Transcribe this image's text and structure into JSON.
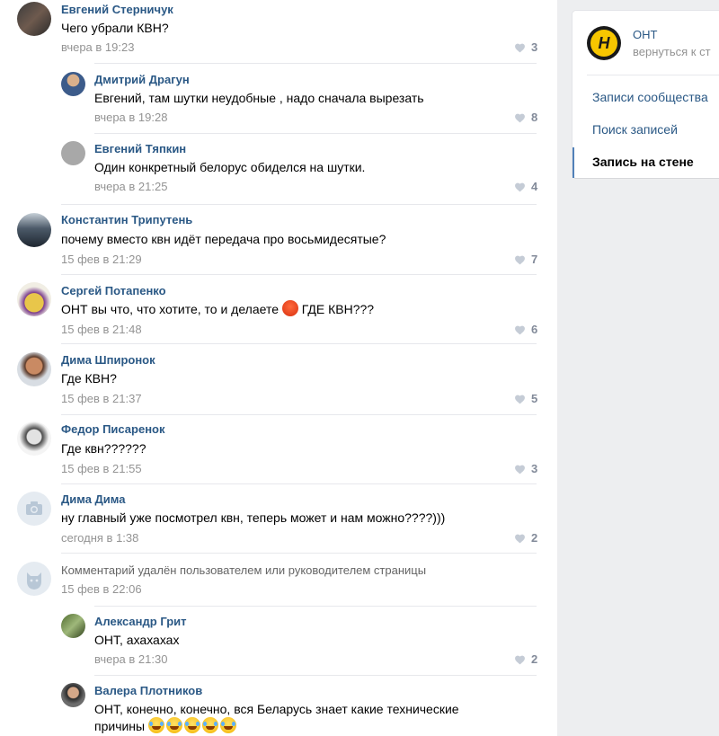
{
  "comments": [
    {
      "author": "Евгений Стерничук",
      "text": "Чего убрали КВН?",
      "date": "вчера в 19:23",
      "likes": "3"
    },
    {
      "author": "Дмитрий Драгун",
      "text": "Евгений, там шутки неудобные , надо сначала вырезать",
      "date": "вчера в 19:28",
      "likes": "8"
    },
    {
      "author": "Евгений Тяпкин",
      "text": "Один конкретный белорус обиделся на шутки.",
      "date": "вчера в 21:25",
      "likes": "4"
    },
    {
      "author": "Константин Трипутень",
      "text": "почему вместо квн идёт передача про восьмидесятые?",
      "date": "15 фев в 21:29",
      "likes": "7"
    },
    {
      "author": "Сергей Потапенко",
      "text_a": "ОНТ вы что, что хотите, то и делаете",
      "text_b": "ГДЕ КВН???",
      "date": "15 фев в 21:48",
      "likes": "6"
    },
    {
      "author": "Дима Шпиронок",
      "text": "Где КВН?",
      "date": "15 фев в 21:37",
      "likes": "5"
    },
    {
      "author": "Федор Писаренок",
      "text": "Где квн??????",
      "date": "15 фев в 21:55",
      "likes": "3"
    },
    {
      "author": "Дима Дима",
      "text": "ну главный уже посмотрел квн, теперь может и нам можно????)))",
      "date": "сегодня в 1:38",
      "likes": "2"
    },
    {
      "deleted_text": "Комментарий удалён пользователем или руководителем страницы",
      "date": "15 фев в 22:06"
    },
    {
      "author": "Александр Грит",
      "text": "ОНТ, ахахахах",
      "date": "вчера в 21:30",
      "likes": "2"
    },
    {
      "author": "Валера Плотников",
      "text_line1": "ОНТ, конечно, конечно, вся Беларусь знает какие технические",
      "text_line2": "причины"
    }
  ],
  "sidebar": {
    "group_name": "ОНТ",
    "back_link": "вернуться к ст",
    "menu": [
      "Записи сообщества",
      "Поиск записей",
      "Запись на стене"
    ]
  },
  "colors": {
    "link": "#2a5885",
    "meta": "#939393",
    "accent": "#5181b8",
    "background": "#edeef0"
  }
}
